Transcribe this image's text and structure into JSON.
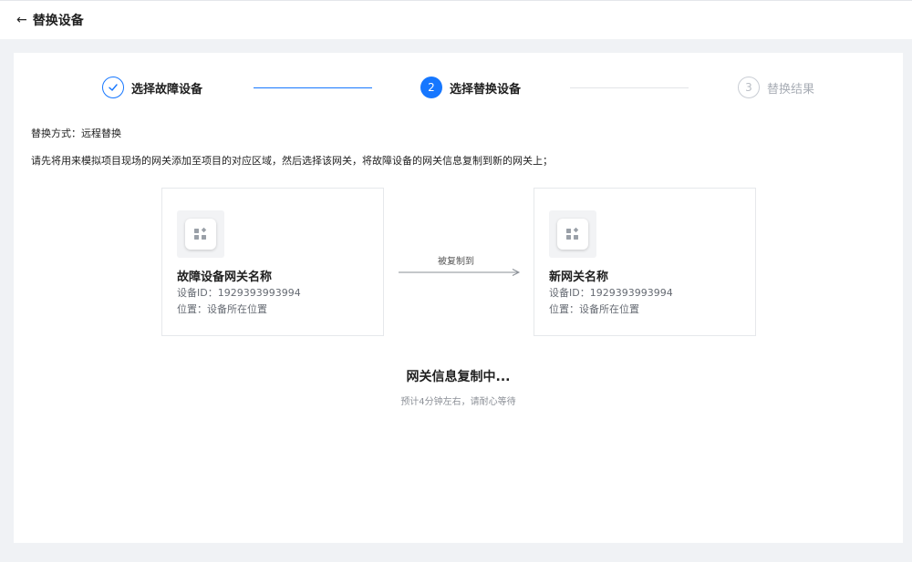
{
  "header": {
    "back_icon": "arrow-left-icon",
    "title": "替换设备"
  },
  "steps": [
    {
      "label": "选择故障设备",
      "status": "done",
      "icon": "check-icon"
    },
    {
      "label": "选择替换设备",
      "status": "active",
      "number": "2"
    },
    {
      "label": "替换结果",
      "status": "wait",
      "number": "3"
    }
  ],
  "replace_method": "替换方式：远程替换",
  "instruction": "请先将用来模拟项目现场的网关添加至项目的对应区域，然后选择该网关，将故障设备的网关信息复制到新的网关上；",
  "source_device": {
    "icon": "gateway-icon",
    "name": "故障设备网关名称",
    "id_label": "设备ID：",
    "id": "1929393993994",
    "location_label": "位置：",
    "location": "设备所在位置"
  },
  "copy_label": "被复制到",
  "target_device": {
    "icon": "gateway-icon",
    "name": "新网关名称",
    "id_label": "设备ID：",
    "id": "1929393993994",
    "location_label": "位置：",
    "location": "设备所在位置"
  },
  "status": {
    "title": "网关信息复制中...",
    "subtitle": "预计4分钟左右，请耐心等待"
  },
  "colors": {
    "primary": "#1677ff",
    "background": "#f0f2f5",
    "muted": "#a8adb5"
  }
}
